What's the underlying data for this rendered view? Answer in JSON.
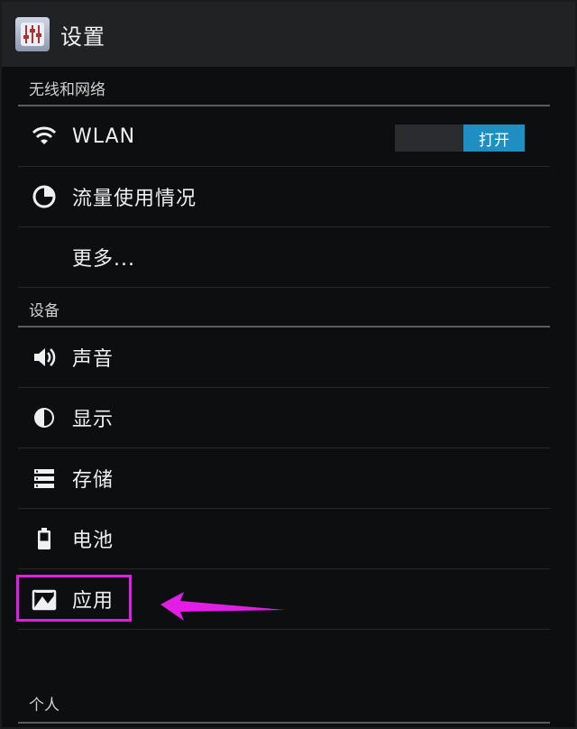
{
  "app": {
    "title": "设置",
    "icon": "settings-equalizer-icon"
  },
  "sections": {
    "wireless": {
      "header": "无线和网络",
      "wlan": {
        "label": "WLAN",
        "icon": "wifi-icon",
        "toggle_label": "打开",
        "toggle_color": "#1e8ec3"
      },
      "data_usage": {
        "label": "流量使用情况",
        "icon": "data-usage-icon"
      },
      "more": {
        "label": "更多..."
      }
    },
    "device": {
      "header": "设备",
      "sound": {
        "label": "声音",
        "icon": "speaker-icon"
      },
      "display": {
        "label": "显示",
        "icon": "brightness-icon"
      },
      "storage": {
        "label": "存储",
        "icon": "storage-icon"
      },
      "battery": {
        "label": "电池",
        "icon": "battery-icon"
      },
      "apps": {
        "label": "应用",
        "icon": "apps-icon"
      }
    },
    "personal": {
      "header": "个人"
    }
  },
  "annotation": {
    "highlight_color": "#e01ee4",
    "arrow_color": "#e01ee4"
  }
}
